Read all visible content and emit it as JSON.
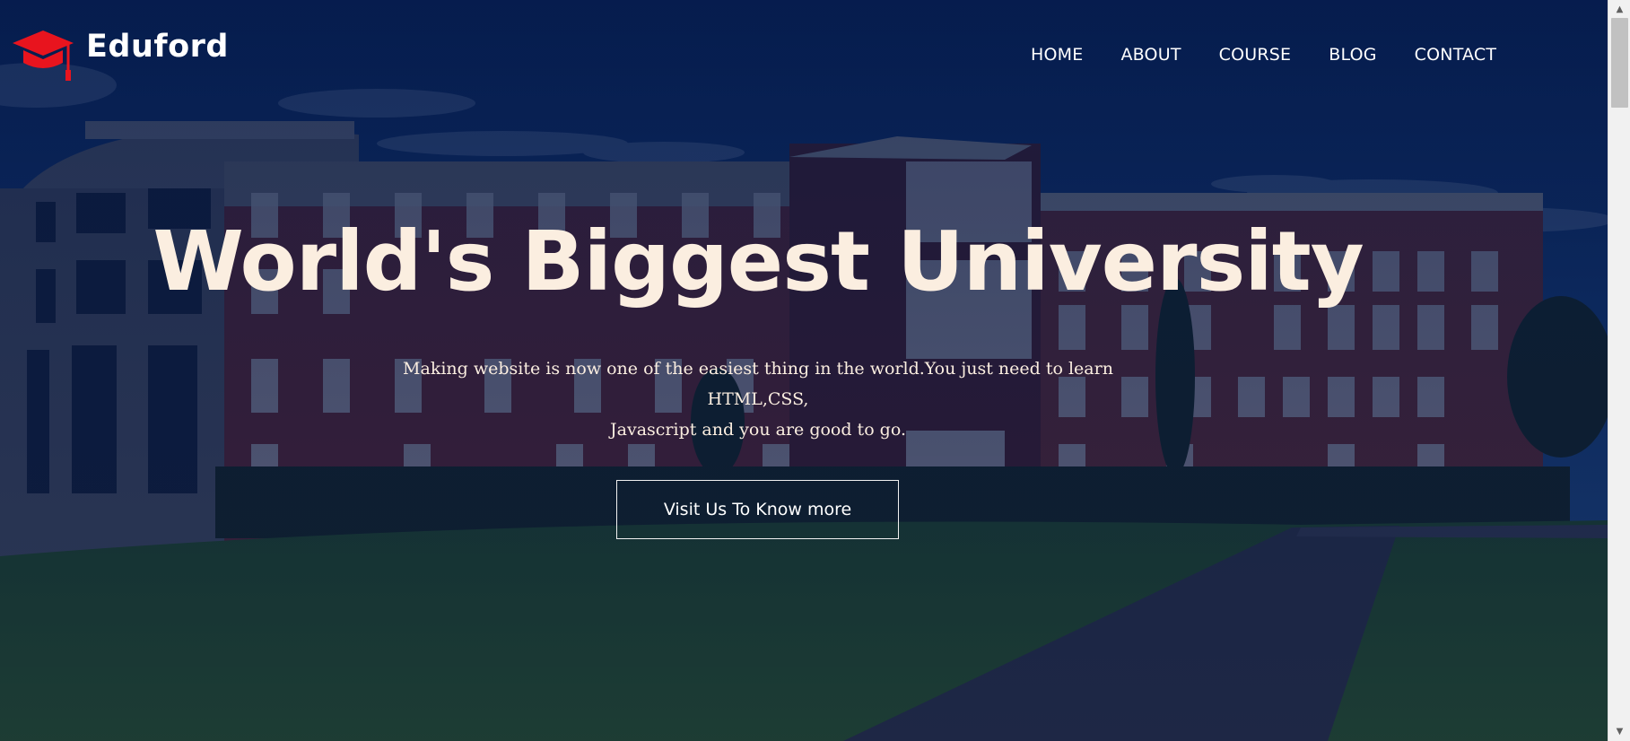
{
  "brand": {
    "name": "Eduford",
    "icon": "graduation-cap-icon",
    "icon_color": "#e8141e"
  },
  "nav": {
    "items": [
      {
        "label": "HOME"
      },
      {
        "label": "ABOUT"
      },
      {
        "label": "COURSE"
      },
      {
        "label": "BLOG"
      },
      {
        "label": "CONTACT"
      }
    ]
  },
  "hero": {
    "headline": "World's Biggest University",
    "subtitle_line1": "Making website is now one of the easiest thing in the world.You just need to learn HTML,CSS,",
    "subtitle_line2": "Javascript and you are good to go.",
    "cta_label": "Visit Us To Know more",
    "background": "university-building-photo",
    "overlay_color": "#041744",
    "text_color": "#fbeee0"
  },
  "scrollbar": {
    "up_icon": "scroll-up-arrow-icon",
    "down_icon": "scroll-down-arrow-icon"
  }
}
